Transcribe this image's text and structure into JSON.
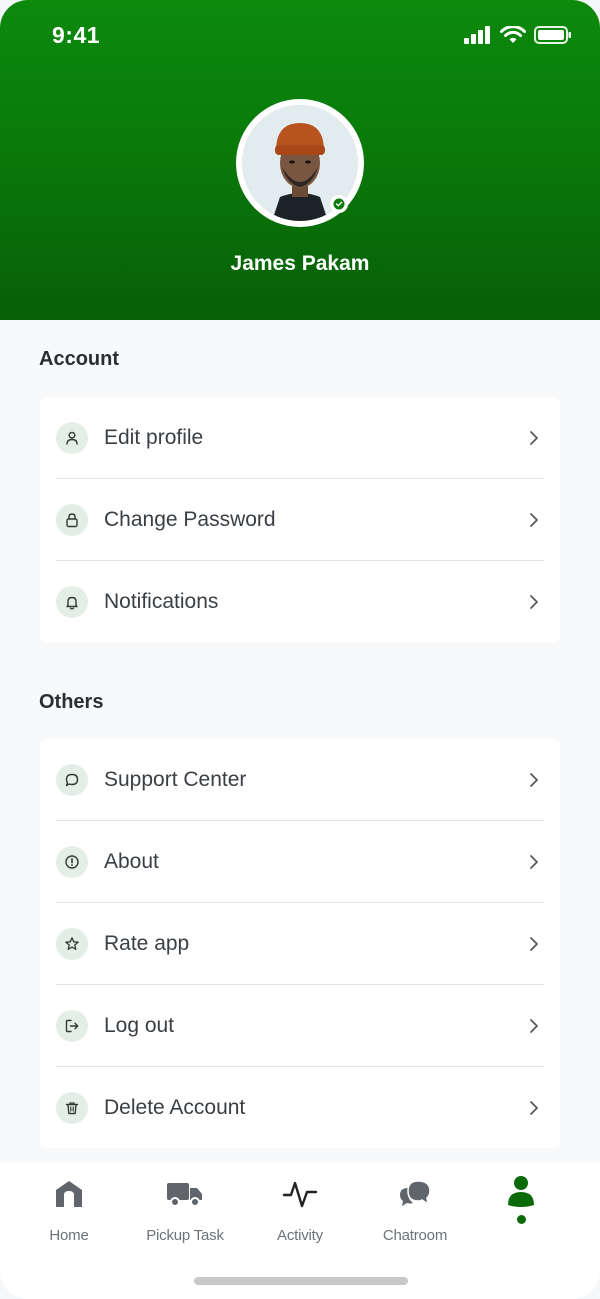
{
  "status_bar": {
    "time": "9:41"
  },
  "profile": {
    "name": "James Pakam"
  },
  "sections": [
    {
      "title": "Account",
      "items": [
        {
          "label": "Edit profile",
          "icon": "user-icon"
        },
        {
          "label": "Change Password",
          "icon": "lock-icon"
        },
        {
          "label": "Notifications",
          "icon": "bell-icon"
        }
      ]
    },
    {
      "title": "Others",
      "items": [
        {
          "label": "Support Center",
          "icon": "chat-bubble-icon"
        },
        {
          "label": "About",
          "icon": "info-icon"
        },
        {
          "label": "Rate app",
          "icon": "star-icon"
        },
        {
          "label": "Log out",
          "icon": "logout-icon"
        },
        {
          "label": "Delete Account",
          "icon": "trash-icon"
        }
      ]
    }
  ],
  "bottom_nav": {
    "items": [
      {
        "label": "Home",
        "icon": "home-icon"
      },
      {
        "label": "Pickup Task",
        "icon": "truck-icon"
      },
      {
        "label": "Activity",
        "icon": "activity-icon"
      },
      {
        "label": "Chatroom",
        "icon": "chatroom-icon"
      },
      {
        "label": "",
        "icon": "profile-icon",
        "active": true
      }
    ]
  },
  "colors": {
    "brand_green": "#0a7a0a",
    "icon_bg": "#e3efe6",
    "active_nav": "#0b6b0b"
  }
}
